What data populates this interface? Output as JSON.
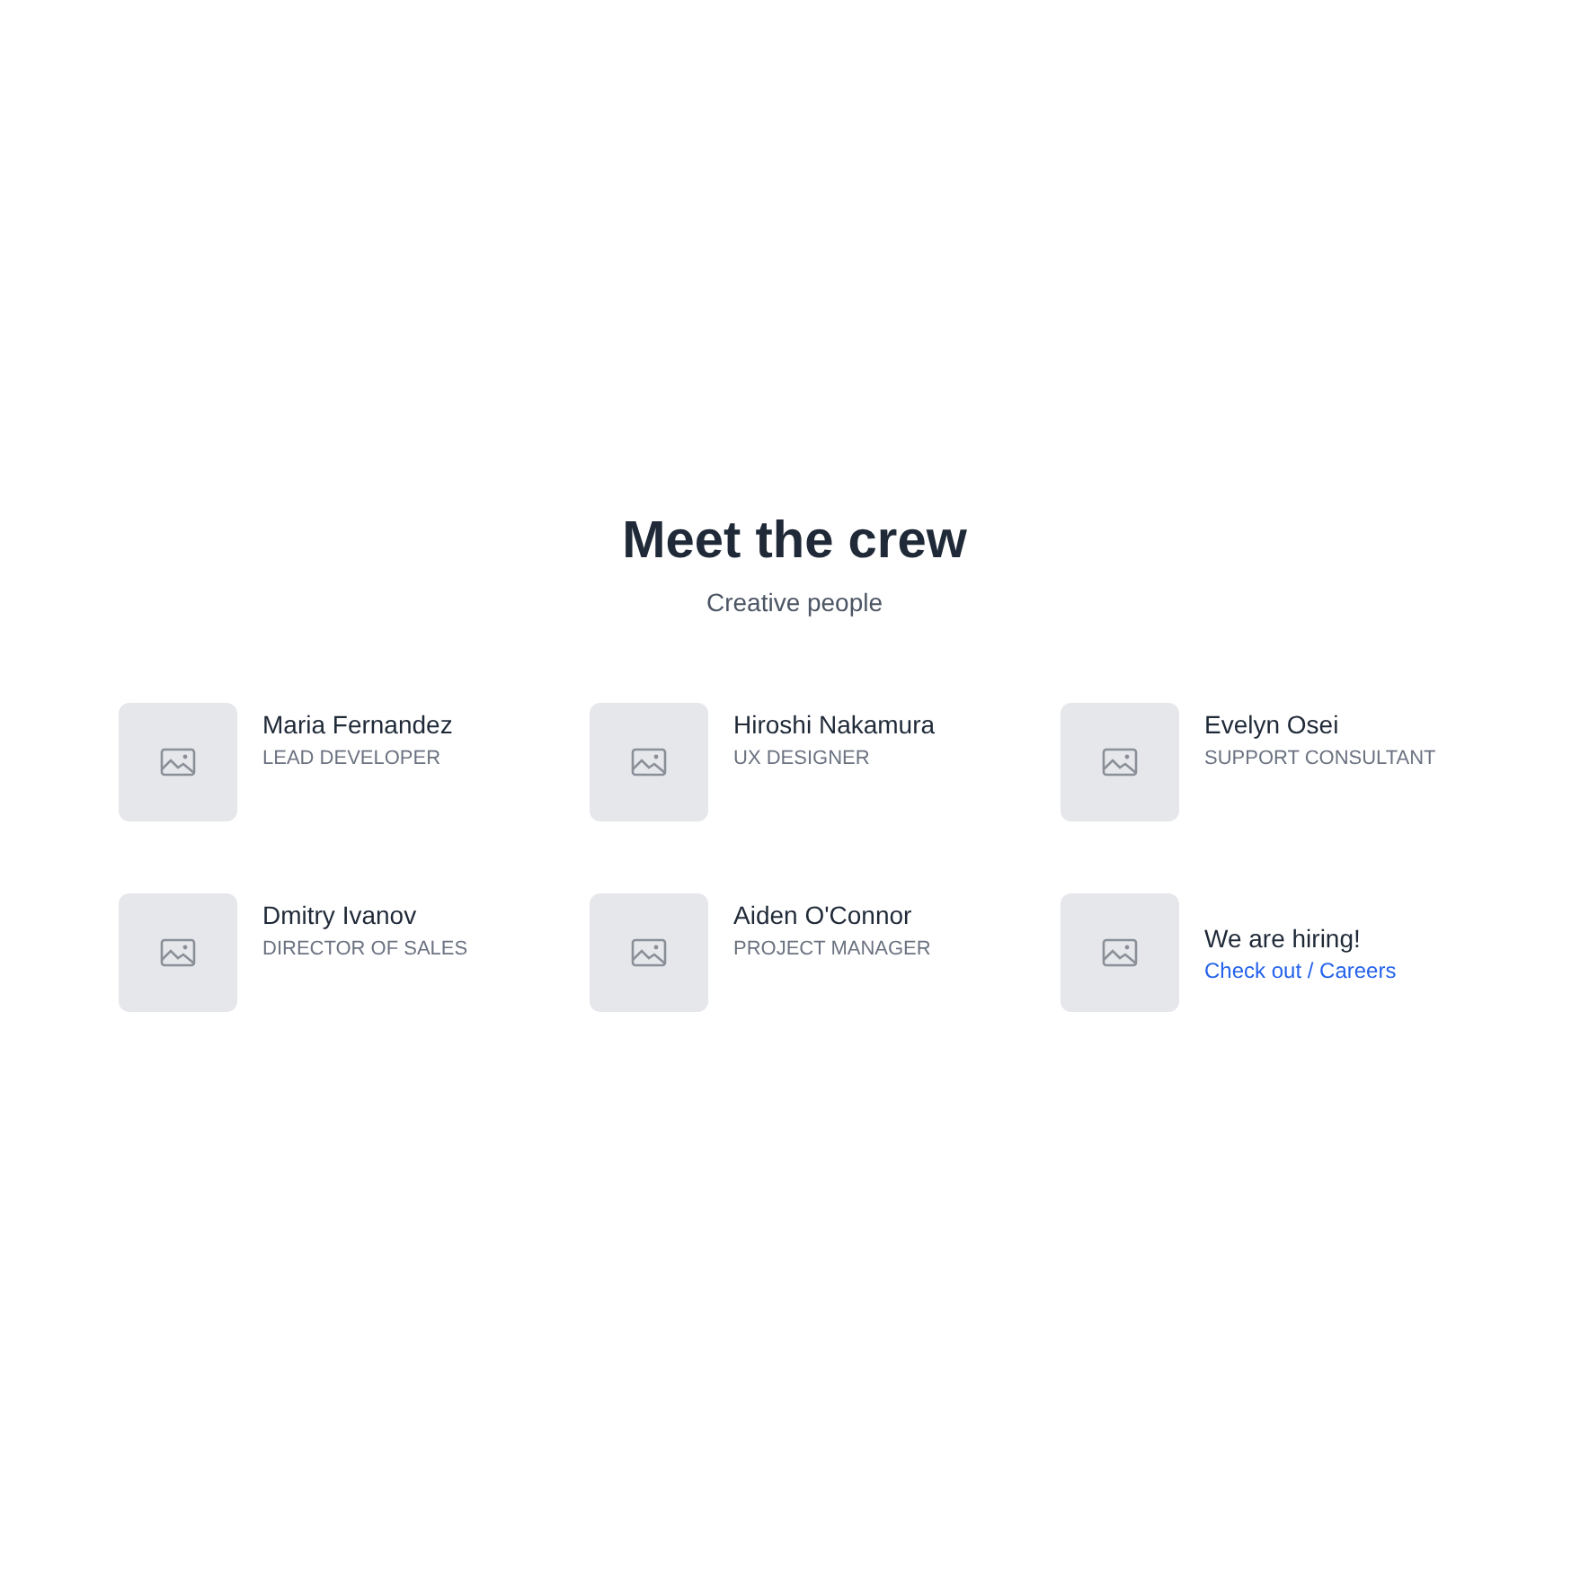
{
  "heading": "Meet the crew",
  "subtitle": "Creative people",
  "members": [
    {
      "kind": "person",
      "name": "Maria Fernandez",
      "role": "LEAD DEVELOPER"
    },
    {
      "kind": "person",
      "name": "Hiroshi Nakamura",
      "role": "UX DESIGNER"
    },
    {
      "kind": "person",
      "name": "Evelyn Osei",
      "role": "SUPPORT CONSULTANT"
    },
    {
      "kind": "person",
      "name": "Dmitry Ivanov",
      "role": "DIRECTOR OF SALES"
    },
    {
      "kind": "person",
      "name": "Aiden O'Connor",
      "role": "PROJECT MANAGER"
    },
    {
      "kind": "hiring",
      "name": "We are hiring!",
      "link": "Check out / Careers"
    }
  ]
}
